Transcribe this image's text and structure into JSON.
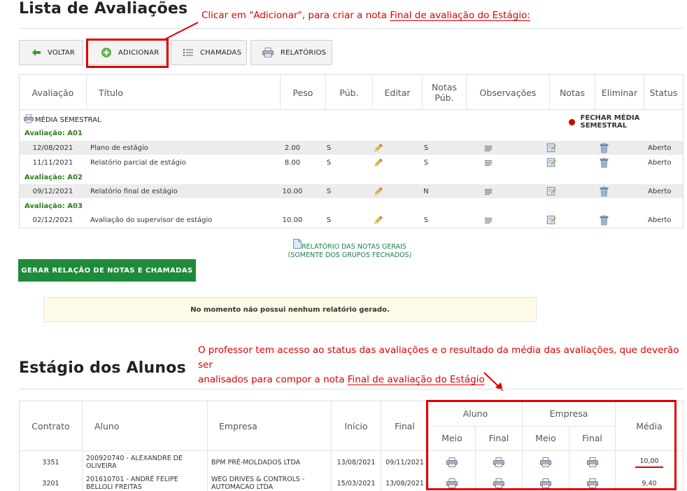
{
  "page": {
    "title1": "Lista de Avaliações",
    "title2": "Estágio dos Alunos"
  },
  "annotations": {
    "a1_pre": "Clicar em \"Adicionar\", para criar a nota ",
    "a1_link": "Final de avaliação do Estágio:",
    "a2_line1": "O professor tem acesso ao status das avaliações e o resultado da média das avaliações, que deverão ser",
    "a2_line2_pre": "analisados para compor a nota  ",
    "a2_link": "Final de avaliação do Estágio"
  },
  "toolbar": {
    "voltar": "VOLTAR",
    "adicionar": "ADICIONAR",
    "chamadas": "CHAMADAS",
    "relatorios": "RELATÓRIOS"
  },
  "eval_table": {
    "headers": [
      "Avaliação",
      "Título",
      "Peso",
      "Púb.",
      "Editar",
      "Notas Púb.",
      "Observações",
      "Notas",
      "Eliminar",
      "Status"
    ],
    "media_label": "MÉDIA SEMESTRAL",
    "fechar_label": "FECHAR MÉDIA SEMESTRAL",
    "groups": [
      "Avaliação: A01",
      "Avaliação: A02",
      "Avaliação: A03"
    ],
    "rows": [
      {
        "date": "12/08/2021",
        "title": "Plano de estágio",
        "peso": "2.00",
        "pub": "S",
        "notas_pub": "S",
        "status": "Aberto"
      },
      {
        "date": "11/11/2021",
        "title": "Relatório parcial de estágio",
        "peso": "8.00",
        "pub": "S",
        "notas_pub": "S",
        "status": "Aberto"
      },
      {
        "date": "09/12/2021",
        "title": "Relatório final de estágio",
        "peso": "10.00",
        "pub": "S",
        "notas_pub": "N",
        "status": "Aberto"
      },
      {
        "date": "02/12/2021",
        "title": "Avaliação do supervisor de estágio",
        "peso": "10.00",
        "pub": "S",
        "notas_pub": "S",
        "status": "Aberto"
      }
    ]
  },
  "report_link": {
    "line1": "RELATÓRIO DAS NOTAS GERAIS",
    "line2": "(SOMENTE DOS GRUPOS FECHADOS)"
  },
  "gerar_button": "GERAR RELAÇÃO DE NOTAS E CHAMADAS",
  "notice": "No momento não possui nenhum relatório gerado.",
  "students_table": {
    "headers": {
      "contrato": "Contrato",
      "aluno": "Aluno",
      "empresa": "Empresa",
      "inicio": "Início",
      "final": "Final",
      "aluno_grp": "Aluno",
      "empresa_grp": "Empresa",
      "meio": "Meio",
      "final_sub": "Final",
      "media": "Média"
    },
    "rows": [
      {
        "contrato": "3351",
        "aluno": "200920740 - ALEXANDRE DE OLIVEIRA",
        "empresa": "BPM PRÉ-MOLDADOS LTDA",
        "inicio": "13/08/2021",
        "final": "09/11/2021",
        "media": "10,00"
      },
      {
        "contrato": "3201",
        "aluno": "201610701 - ANDRÉ FELIPE BELLOLI FREITAS",
        "empresa": "WEG DRIVES & CONTROLS - AUTOMACAO LTDA",
        "inicio": "15/03/2021",
        "final": "13/08/2021",
        "media": "9,40"
      }
    ]
  },
  "colors": {
    "annotation_red": "#e00000",
    "green_button": "#1e8a3a",
    "group_green": "#2e7d1e",
    "link_green": "#1f7d4b",
    "notice_bg": "#fdfbe8"
  },
  "icons": [
    "arrow-left-icon",
    "plus-circle-icon",
    "list-icon",
    "printer-icon",
    "pencil-icon",
    "lines-icon",
    "notepad-icon",
    "trash-icon",
    "red-dot-icon",
    "document-icon"
  ]
}
